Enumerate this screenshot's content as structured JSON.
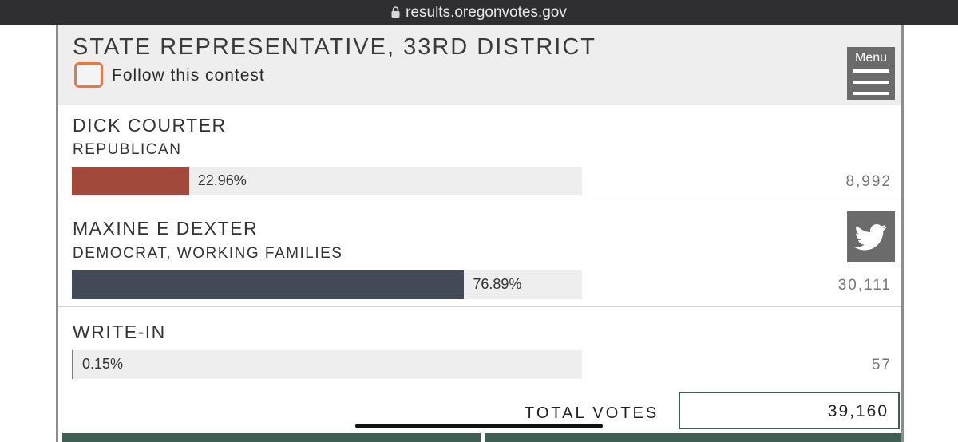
{
  "browser": {
    "url": "results.oregonvotes.gov"
  },
  "contest": {
    "title": "STATE REPRESENTATIVE, 33RD DISTRICT",
    "follow_label": "Follow this contest",
    "menu_label": "Menu"
  },
  "candidates": [
    {
      "name": "DICK COURTER",
      "party": "REPUBLICAN",
      "percent": 22.96,
      "percent_label": "22.96%",
      "votes": "8,992",
      "bar_color": "#a14a3b"
    },
    {
      "name": "MAXINE E DEXTER",
      "party": "DEMOCRAT, WORKING FAMILIES",
      "percent": 76.89,
      "percent_label": "76.89%",
      "votes": "30,111",
      "bar_color": "#434a57"
    },
    {
      "name": "WRITE-IN",
      "party": "",
      "percent": 0.15,
      "percent_label": "0.15%",
      "votes": "57",
      "bar_color": "#777777"
    }
  ],
  "totals": {
    "label": "TOTAL VOTES",
    "value": "39,160"
  },
  "colors": {
    "follow_checkbox": "#e07b44",
    "footer_green": "#3f5f54",
    "button_gray": "#6b6b6b"
  },
  "icons": [
    "lock-icon",
    "menu-icon",
    "twitter-icon"
  ]
}
